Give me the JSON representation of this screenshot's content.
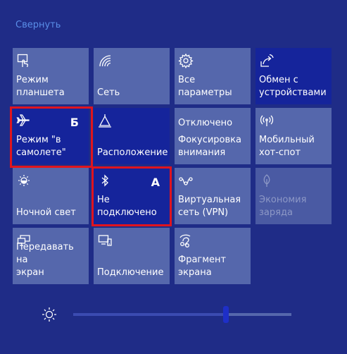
{
  "header": {
    "collapse_label": "Свернуть"
  },
  "tiles": [
    {
      "label": "Режим\nпланшета",
      "state": "off",
      "icon": "tablet-mode-icon"
    },
    {
      "label": "Сеть",
      "state": "off",
      "icon": "network-icon"
    },
    {
      "label": "Все параметры",
      "state": "off",
      "icon": "settings-gear-icon"
    },
    {
      "label": "Обмен с\nустройствами",
      "state": "on",
      "icon": "nearby-sharing-icon"
    },
    {
      "label": "Режим \"в\nсамолете\"",
      "state": "on",
      "icon": "airplane-icon",
      "marker": "Б"
    },
    {
      "label": "Расположение",
      "state": "on",
      "icon": "location-icon"
    },
    {
      "status": "Отключено",
      "label": "Фокусировка\nвнимания",
      "state": "off",
      "icon": "focus-assist-icon"
    },
    {
      "label": "Мобильный\nхот-спот",
      "state": "off",
      "icon": "mobile-hotspot-icon"
    },
    {
      "label": "Ночной свет",
      "state": "off",
      "icon": "night-light-icon"
    },
    {
      "label": "Не\nподключено",
      "state": "on",
      "icon": "bluetooth-icon",
      "marker": "А"
    },
    {
      "label": "Виртуальная\nсеть (VPN)",
      "state": "off",
      "icon": "vpn-icon"
    },
    {
      "label": "Экономия\nзаряда",
      "state": "disabled",
      "icon": "battery-saver-icon"
    },
    {
      "label": "Передавать на\nэкран",
      "state": "off",
      "icon": "project-icon"
    },
    {
      "label": "Подключение",
      "state": "off",
      "icon": "connect-icon"
    },
    {
      "label": "Фрагмент\nэкрана",
      "state": "off",
      "icon": "screen-snip-icon"
    }
  ],
  "brightness": {
    "icon": "brightness-sun-icon",
    "level_fraction": 0.7
  },
  "colors": {
    "background": "#1f2c87",
    "tile_off": "#5567ac",
    "tile_on": "#15249b",
    "highlight": "#e0141e",
    "collapse_link": "#5a8ee8"
  }
}
